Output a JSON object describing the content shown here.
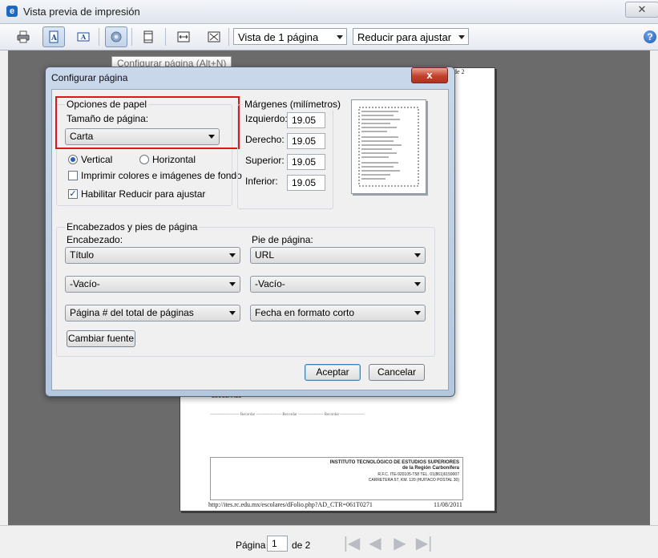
{
  "window": {
    "title": "Vista previa de impresión",
    "close_glyph": "✕",
    "app_icon": "ie-icon"
  },
  "toolbar": {
    "view_mode": "Vista de 1 página",
    "fit_mode": "Reducir para ajustar",
    "icons": [
      "printer-icon",
      "portrait-icon",
      "landscape-icon",
      "page-setup-gear-icon",
      "headers-footers-icon",
      "full-width-icon",
      "full-page-icon"
    ],
    "help": "?"
  },
  "tooltip": "Configurar página (Alt+N)",
  "dialog": {
    "title": "Configurar página",
    "close": "x",
    "paper": {
      "group_label": "Opciones de papel",
      "size_label": "Tamaño de página:",
      "size_value": "Carta",
      "orientation_vertical": "Vertical",
      "orientation_horizontal": "Horizontal",
      "vertical_selected": true,
      "print_bg_label": "Imprimir colores e imágenes de fondo",
      "print_bg_checked": false,
      "shrink_label": "Habilitar Reducir para ajustar",
      "shrink_checked": true
    },
    "margins": {
      "group_label": "Márgenes (milímetros)",
      "left_label": "Izquierdo:",
      "left_value": "19.05",
      "right_label": "Derecho:",
      "right_value": "19.05",
      "top_label": "Superior:",
      "top_value": "19.05",
      "bottom_label": "Inferior:",
      "bottom_value": "19.05"
    },
    "headers": {
      "group_label": "Encabezados y pies de página",
      "header_label": "Encabezado:",
      "footer_label": "Pie de página:",
      "header_1": "Título",
      "header_2": "-Vacío-",
      "header_3": "Página # del total de páginas",
      "footer_1": "URL",
      "footer_2": "-Vacío-",
      "footer_3": "Fecha en formato corto",
      "font_button": "Cambiar fuente"
    },
    "ok": "Aceptar",
    "cancel": "Cancelar"
  },
  "page_preview": {
    "page_marker": "de 2",
    "stamp_text": "ESCOLARES",
    "signature_line": "---------------------- Recordar ------------------- Recordar ------------------- Recordar ------------------",
    "institute_line1": "INSTITUTO TECNOLÓGICO DE ESTUDIOS SUPERIORES",
    "institute_line2": "de la Región Carbonífera",
    "institute_line3": "R.F.C. ITE-920105-T58 TEL. 01(861)6159007",
    "institute_line4": "CARRETERA 57, KM. 120 (HUITACO POSTAL 30)",
    "footer_url": "http://ites.rc.edu.mx/escolares/dFolio.php?AD_CTR=061T0271",
    "footer_date": "11/08/2011"
  },
  "navigation": {
    "page_label": "Página",
    "page_value": "1",
    "page_of": "de 2",
    "first": "|◀",
    "prev": "◀",
    "next": "▶",
    "last": "▶|"
  }
}
